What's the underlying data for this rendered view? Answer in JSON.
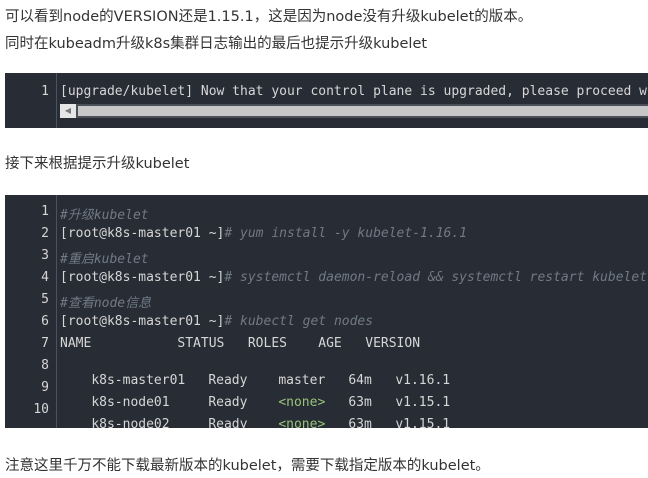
{
  "paragraphs": {
    "p1": "可以看到node的VERSION还是1.15.1，这是因为node没有升级kubelet的版本。",
    "p2": "同时在kubeadm升级k8s集群日志输出的最后也提示升级kubelet",
    "p3": "接下来根据提示升级kubelet",
    "p4": "注意这里千万不能下载最新版本的kubelet，需要下载指定版本的kubelet。"
  },
  "code1": {
    "line_numbers": [
      "1"
    ],
    "line1": "[upgrade/kubelet] Now that your control plane is upgraded, please proceed with",
    "scroll_left_glyph": "◀"
  },
  "code2": {
    "line_numbers": [
      "1",
      "2",
      "3",
      "4",
      "5",
      "6",
      "7",
      "8",
      "9",
      "10"
    ],
    "l1_comment": "#升级kubelet",
    "l2_prompt": "[root@k8s-master01 ~]",
    "l2_comment": "# yum install -y kubelet-1.16.1",
    "l3_comment": "#重启kubelet",
    "l4_prompt": "[root@k8s-master01 ~]",
    "l4_comment": "# systemctl daemon-reload && systemctl restart kubelet",
    "l5_comment": "#查看node信息",
    "l6_prompt": "[root@k8s-master01 ~]",
    "l6_comment": "# kubectl get nodes",
    "table_header": "NAME           STATUS   ROLES    AGE   VERSION",
    "row1": {
      "name": "k8s-master01",
      "status": "Ready",
      "roles": "master",
      "age": "64m",
      "version": "v1.16.1"
    },
    "row2": {
      "name": "k8s-node01",
      "status": "Ready",
      "roles": "<none>",
      "age": "63m",
      "version": "v1.15.1"
    },
    "row3": {
      "name": "k8s-node02",
      "status": "Ready",
      "roles": "<none>",
      "age": "63m",
      "version": "v1.15.1"
    }
  }
}
